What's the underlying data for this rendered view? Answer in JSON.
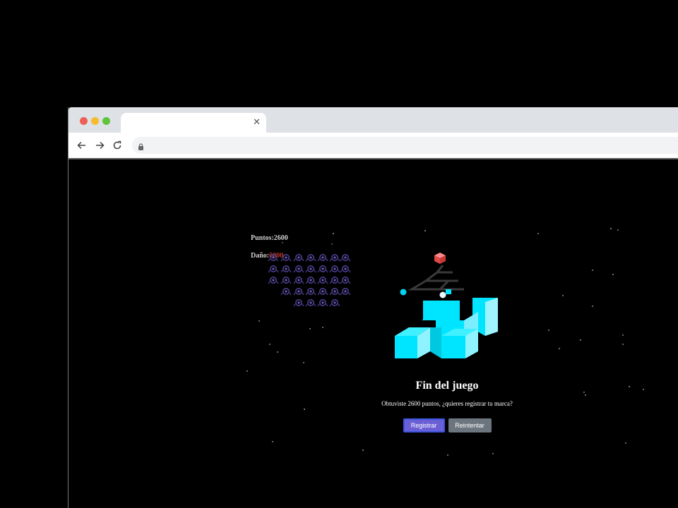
{
  "browser": {
    "tab_title": "",
    "tab_close_icon": "close-icon",
    "url": ""
  },
  "hud": {
    "score_label": "Puntos:",
    "score_value": "2600",
    "damage_label": "Daño:",
    "damage_value": "0000"
  },
  "game_over": {
    "title": "Fin del juego",
    "message": "Obtuviste 2600 puntos, ¿quieres registrar tu marca?",
    "register_button": "Registrar",
    "retry_button": "Reintentar"
  },
  "colors": {
    "background": "#000000",
    "hero_cyan": "#00e5ff",
    "invader_purple": "#4b3f8f",
    "primary_button": "#6b5fd6",
    "secondary_button": "#6c757d"
  }
}
